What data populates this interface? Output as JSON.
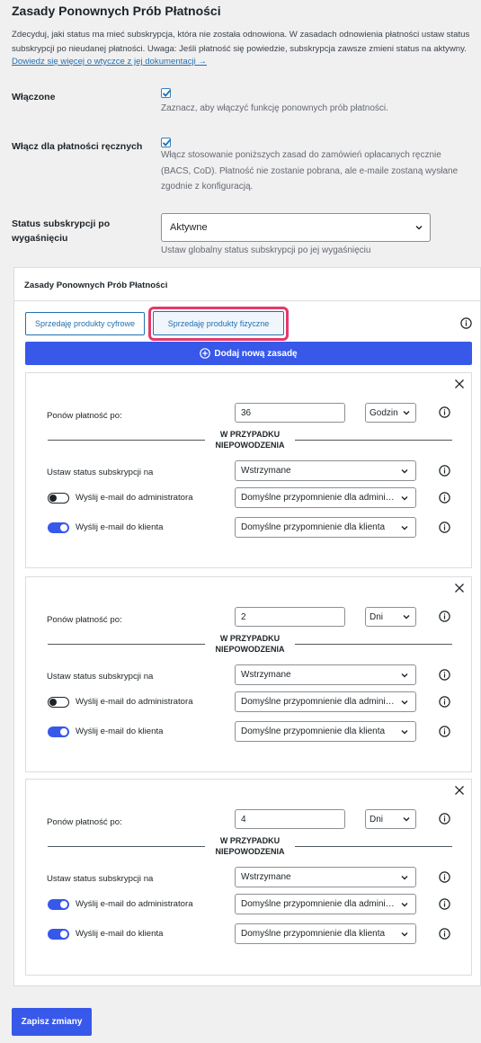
{
  "page": {
    "title": "Zasady Ponownych Prób Płatności",
    "description": "Zdecyduj, jaki status ma mieć subskrypcja, która nie została odnowiona. W zasadach odnowienia płatności ustaw status subskrypcji po nieudanej płatności. Uwaga: Jeśli płatność się powiedzie, subskrypcja zawsze zmieni status na aktywny.",
    "doc_link": "Dowiedz się więcej o wtyczce z jej dokumentacji →"
  },
  "settings": {
    "enabled": {
      "label": "Włączone",
      "checked": true,
      "help": "Zaznacz, aby włączyć funkcję ponownych prób płatności."
    },
    "manual": {
      "label": "Włącz dla płatności ręcznych",
      "checked": true,
      "help": "Włącz stosowanie poniższych zasad do zamówień opłacanych ręcznie (BACS, CoD). Płatność nie zostanie pobrana, ale e-maile zostaną wysłane zgodnie z konfiguracją."
    },
    "expiry": {
      "label": "Status subskrypcji po wygaśnięciu",
      "value": "Aktywne",
      "help": "Ustaw globalny status subskrypcji po jej wygaśnięciu"
    }
  },
  "panel": {
    "title": "Zasady Ponownych Prób Płatności",
    "tabs": [
      "Sprzedaję produkty cyfrowe",
      "Sprzedaję produkty fizyczne"
    ],
    "active_tab": 1,
    "add_label": "Dodaj nową zasadę"
  },
  "rule_labels": {
    "retry_after": "Ponów płatność po:",
    "on_failure": "W PRZYPADKU NIEPOWODZENIA",
    "set_status": "Ustaw status subskrypcji na",
    "email_admin": "Wyślij e-mail do administratora",
    "email_client": "Wyślij e-mail do klienta"
  },
  "rules": [
    {
      "retry_value": "36",
      "retry_unit": "Godzin",
      "status": "Wstrzymane",
      "admin_on": false,
      "admin_template": "Domyślne przypomnienie dla administratora",
      "client_on": true,
      "client_template": "Domyślne przypomnienie dla klienta"
    },
    {
      "retry_value": "2",
      "retry_unit": "Dni",
      "status": "Wstrzymane",
      "admin_on": false,
      "admin_template": "Domyślne przypomnienie dla administratora",
      "client_on": true,
      "client_template": "Domyślne przypomnienie dla klienta"
    },
    {
      "retry_value": "4",
      "retry_unit": "Dni",
      "status": "Wstrzymane",
      "admin_on": true,
      "admin_template": "Domyślne przypomnienie dla administratora",
      "client_on": true,
      "client_template": "Domyślne przypomnienie dla klienta"
    }
  ],
  "save_label": "Zapisz zmiany",
  "colors": {
    "accent": "#3858e9",
    "link": "#2271b1",
    "highlight": "#e4396b"
  },
  "icons": [
    "check-icon",
    "chevron-down-icon",
    "info-icon",
    "close-icon",
    "plus-circle-icon"
  ]
}
